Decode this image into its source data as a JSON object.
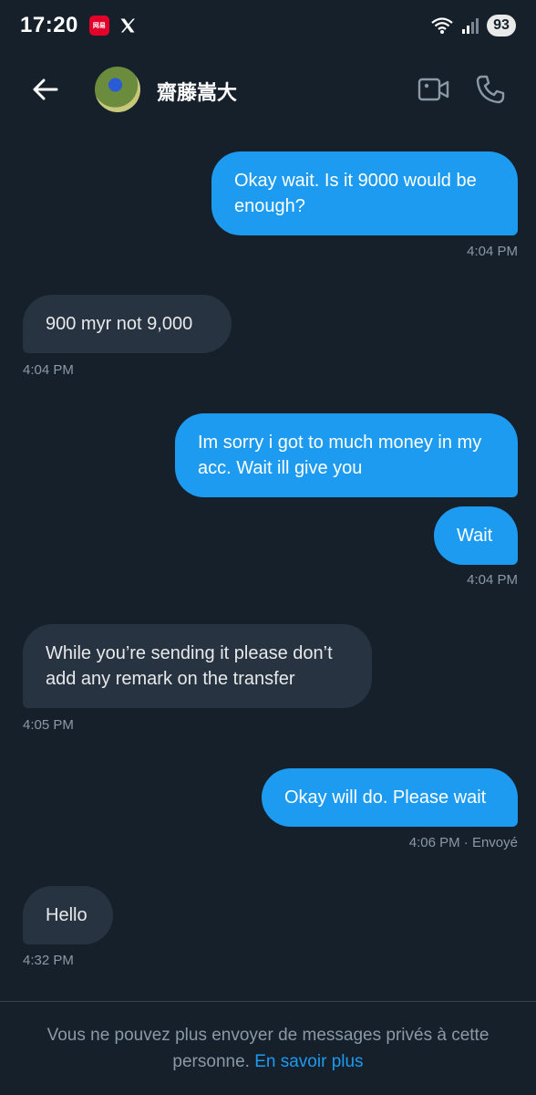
{
  "status_bar": {
    "time": "17:20",
    "notification_app_label": "网易",
    "battery": "93",
    "icons": [
      "notification-app-icon",
      "x-logo-icon",
      "wifi-icon",
      "signal-icon"
    ]
  },
  "header": {
    "contact_name": "齋藤嵩大",
    "icons": [
      "back-arrow-icon",
      "avatar",
      "video-call-icon",
      "phone-icon"
    ]
  },
  "messages": [
    {
      "direction": "sent",
      "lines": [
        "Okay wait. Is it 9000 would be",
        "enough?"
      ],
      "time": "4:04 PM"
    },
    {
      "direction": "received",
      "lines": [
        "900 myr not 9,000"
      ],
      "time": "4:04 PM"
    },
    {
      "direction": "sent",
      "lines": [
        "Im sorry i got to much money in my",
        "acc. Wait ill give you"
      ]
    },
    {
      "direction": "sent",
      "lines": [
        "Wait"
      ],
      "time": "4:04 PM"
    },
    {
      "direction": "received",
      "lines": [
        "While you’re sending it please don’t",
        "add any remark on the transfer"
      ],
      "time": "4:05 PM"
    },
    {
      "direction": "sent",
      "lines": [
        "Okay will do. Please wait"
      ],
      "time": "4:06 PM · Envoyé"
    },
    {
      "direction": "received",
      "lines": [
        "Hello"
      ],
      "time": "4:32 PM"
    }
  ],
  "footer": {
    "notice": "Vous ne pouvez plus envoyer de messages privés à cette personne.",
    "link": "En savoir plus"
  },
  "colors": {
    "background": "#15202b",
    "sent_bubble": "#1d9bf0",
    "received_bubble": "#273340",
    "timestamp": "#8b98a5",
    "link": "#1d9bf0"
  }
}
